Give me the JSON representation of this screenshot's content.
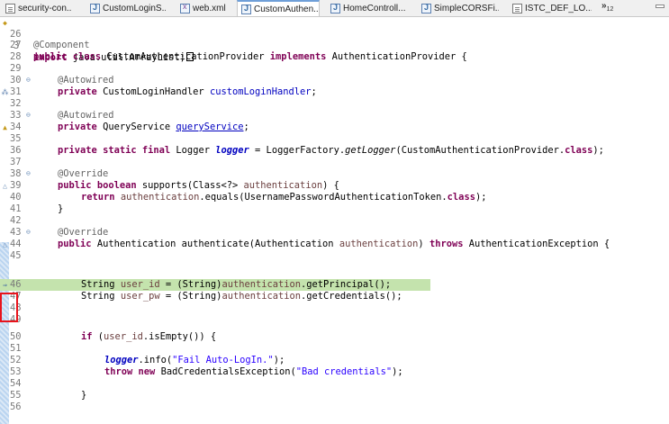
{
  "tabs": [
    {
      "label": "security-con...",
      "icon": "file-icon",
      "active": false
    },
    {
      "label": "CustomLoginS...",
      "icon": "java-file-icon",
      "active": false
    },
    {
      "label": "web.xml",
      "icon": "xml-file-icon",
      "active": false
    },
    {
      "label": "CustomAuthen...",
      "icon": "java-file-icon",
      "active": true,
      "close": "⊠"
    },
    {
      "label": "HomeControll...",
      "icon": "java-file-icon",
      "active": false
    },
    {
      "label": "SimpleCORSFi...",
      "icon": "java-file-icon",
      "active": false
    },
    {
      "label": "ISTC_DEF_LO...",
      "icon": "file-icon",
      "active": false
    }
  ],
  "overflow_label": "»",
  "overflow_count": "12",
  "colors": {
    "keyword": "#7f0055",
    "field": "#0000c0",
    "string": "#2a00ff",
    "annotation": "#646464",
    "highlight": "#c4e3ad",
    "red_box": "#e8141c"
  },
  "code": {
    "l3": {
      "num": "3",
      "kw": "import",
      "rest": "java.util.ArrayList;"
    },
    "l26": {
      "num": "26"
    },
    "l27": {
      "num": "27",
      "ann": "@Component"
    },
    "l28": {
      "num": "28",
      "kw1": "public",
      "kw2": "class",
      "name": "CustomAuthenticationProvider",
      "kw3": "implements",
      "iface": "AuthenticationProvider {"
    },
    "l29": {
      "num": "29"
    },
    "l30": {
      "num": "30",
      "ann": "@Autowired"
    },
    "l31": {
      "num": "31",
      "kw": "private",
      "type": "CustomLoginHandler",
      "field": "customLoginHandler",
      "end": ";"
    },
    "l32": {
      "num": "32"
    },
    "l33": {
      "num": "33",
      "ann": "@Autowired"
    },
    "l34": {
      "num": "34",
      "kw": "private",
      "type": "QueryService",
      "field": "queryService",
      "end": ";"
    },
    "l35": {
      "num": "35"
    },
    "l36": {
      "num": "36",
      "kw1": "private",
      "kw2": "static",
      "kw3": "final",
      "type": "Logger",
      "field": "logger",
      "mid": "= LoggerFactory.",
      "meth": "getLogger",
      "arg": "(CustomAuthenticationProvider.",
      "kw4": "class",
      "end": ");"
    },
    "l37": {
      "num": "37"
    },
    "l38": {
      "num": "38",
      "ann": "@Override"
    },
    "l39": {
      "num": "39",
      "kw1": "public",
      "kw2": "boolean",
      "sig": "supports(Class<?>",
      "param": "authentication",
      "end": ") {"
    },
    "l40": {
      "num": "40",
      "kw": "return",
      "param": "authentication",
      "mid": ".equals(UsernamePasswordAuthenticationToken.",
      "kw2": "class",
      "end": ");"
    },
    "l41": {
      "num": "41",
      "text": "}"
    },
    "l42": {
      "num": "42"
    },
    "l43": {
      "num": "43",
      "ann": "@Override"
    },
    "l44": {
      "num": "44",
      "kw": "public",
      "sig": "Authentication authenticate(Authentication",
      "param": "authentication",
      "close": ")",
      "kw2": "throws",
      "end": "AuthenticationException {"
    },
    "l45": {
      "num": "45"
    },
    "l46": {
      "num": "46",
      "type": "String",
      "var": "user_id",
      "mid": "= (String)",
      "param": "authentication",
      "end": ".getPrincipal();"
    },
    "l47": {
      "num": "47",
      "type": "String",
      "var": "user_pw",
      "mid": "= (String)",
      "param": "authentication",
      "end": ".getCredentials();"
    },
    "l48": {
      "num": "48"
    },
    "l49": {
      "num": "49"
    },
    "l50": {
      "num": "50",
      "kw": "if",
      "open": "(",
      "var": "user_id",
      "end": ".isEmpty()) {"
    },
    "l51": {
      "num": "51"
    },
    "l52": {
      "num": "52",
      "field": "logger",
      "mid": ".info(",
      "str": "\"Fail Auto-LogIn.\"",
      "end": ");"
    },
    "l53": {
      "num": "53",
      "kw1": "throw",
      "kw2": "new",
      "mid": "BadCredentialsException(",
      "str": "\"Bad credentials\"",
      "end": ");"
    },
    "l54": {
      "num": "54"
    },
    "l55": {
      "num": "55",
      "text": "}"
    },
    "l56": {
      "num": "56"
    }
  }
}
